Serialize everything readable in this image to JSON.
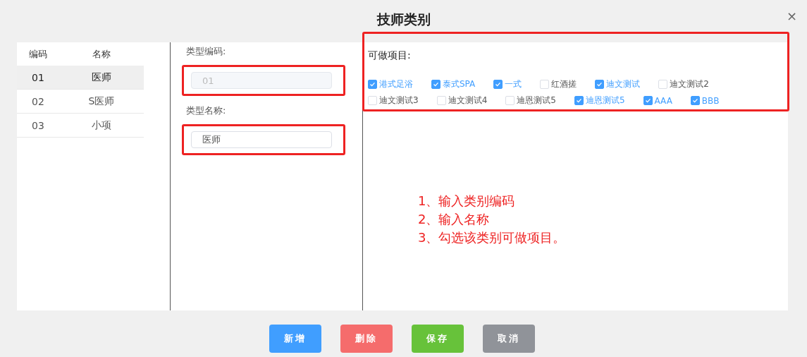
{
  "window": {
    "title": "技师类别",
    "close": "×"
  },
  "list": {
    "columns": [
      "编码",
      "名称"
    ],
    "rows": [
      {
        "code": "01",
        "name": "医师",
        "selected": true
      },
      {
        "code": "02",
        "name": "S医师",
        "selected": false
      },
      {
        "code": "03",
        "name": "小项",
        "selected": false
      }
    ]
  },
  "form": {
    "code_label": "类型编码:",
    "code_value": "01",
    "code_disabled": true,
    "name_label": "类型名称:",
    "name_value": "医师"
  },
  "projects": {
    "label": "可做项目:",
    "items": [
      {
        "label": "港式足浴",
        "checked": true
      },
      {
        "label": "泰式SPA",
        "checked": true
      },
      {
        "label": "一式",
        "checked": true
      },
      {
        "label": "红酒搓",
        "checked": false
      },
      {
        "label": "迪文测试",
        "checked": true
      },
      {
        "label": "迪文测试2",
        "checked": false
      },
      {
        "label": "迪文测试3",
        "checked": false
      },
      {
        "label": "迪文测试4",
        "checked": false
      },
      {
        "label": "迪恩测试5",
        "checked": false
      },
      {
        "label": "迪恩测试5",
        "checked": true
      },
      {
        "label": "AAA",
        "checked": true
      },
      {
        "label": "BBB",
        "checked": true
      }
    ]
  },
  "annotation": [
    "1、输入类别编码",
    "2、输入名称",
    "3、勾选该类别可做项目。"
  ],
  "buttons": [
    {
      "label": "新增",
      "kind": "add"
    },
    {
      "label": "删除",
      "kind": "delete"
    },
    {
      "label": "保存",
      "kind": "save"
    },
    {
      "label": "取消",
      "kind": "cancel"
    }
  ]
}
